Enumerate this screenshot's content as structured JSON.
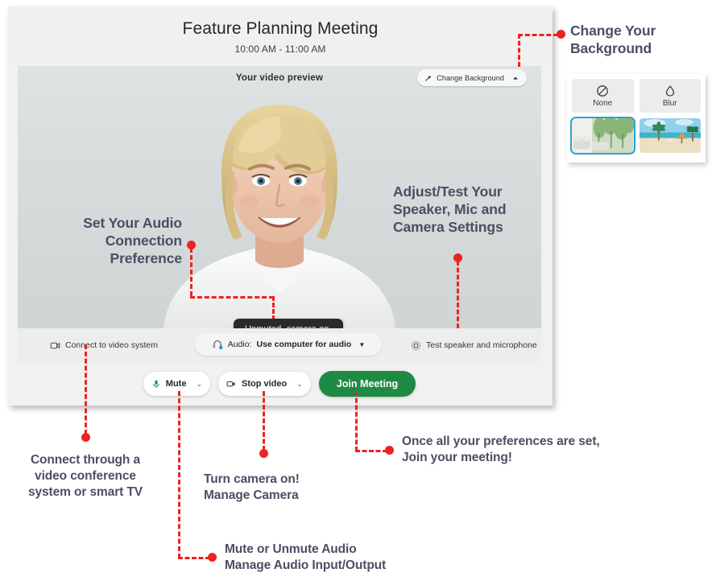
{
  "meeting": {
    "title": "Feature Planning Meeting",
    "time": "10:00 AM - 11:00 AM"
  },
  "video_preview": {
    "label": "Your video preview",
    "change_background_label": "Change Background",
    "status_tooltip": "Unmuted, camera on."
  },
  "options_bar": {
    "connect_video_system": "Connect to video system",
    "audio_prefix": "Audio:",
    "audio_value": "Use computer for audio",
    "test_speaker_mic": "Test speaker and microphone"
  },
  "actions": {
    "mute_label": "Mute",
    "stop_video_label": "Stop video",
    "join_label": "Join Meeting"
  },
  "background_panel": {
    "options": [
      {
        "label": "None",
        "icon": "no-background-icon"
      },
      {
        "label": "Blur",
        "icon": "blur-droplet-icon"
      },
      {
        "label": "",
        "icon": "living-room-thumbnail",
        "selected": true
      },
      {
        "label": "",
        "icon": "beach-thumbnail",
        "selected": false
      }
    ]
  },
  "annotations": {
    "change_background": "Change Your\nBackground",
    "change_background_l1": "Change Your",
    "change_background_l2": "Background",
    "audio_pref_l1": "Set Your Audio",
    "audio_pref_l2": "Connection",
    "audio_pref_l3": "Preference",
    "adjust_test_l1": "Adjust/Test Your",
    "adjust_test_l2": "Speaker, Mic and",
    "adjust_test_l3": "Camera Settings",
    "connect_l1": "Connect through a",
    "connect_l2": "video conference",
    "connect_l3": "system or smart TV",
    "camera_l1": "Turn camera on!",
    "camera_l2": "Manage Camera",
    "join_l1": "Once all your preferences are set,",
    "join_l2": "Join your meeting!",
    "mute_l1": "Mute or Unmute Audio",
    "mute_l2": "Manage Audio Input/Output"
  },
  "colors": {
    "annotation_text": "#4a4f63",
    "callout_red": "#ef2222",
    "join_green": "#1f8a43",
    "selected_blue": "#29a3d6",
    "window_bg": "#f1f1f1"
  }
}
